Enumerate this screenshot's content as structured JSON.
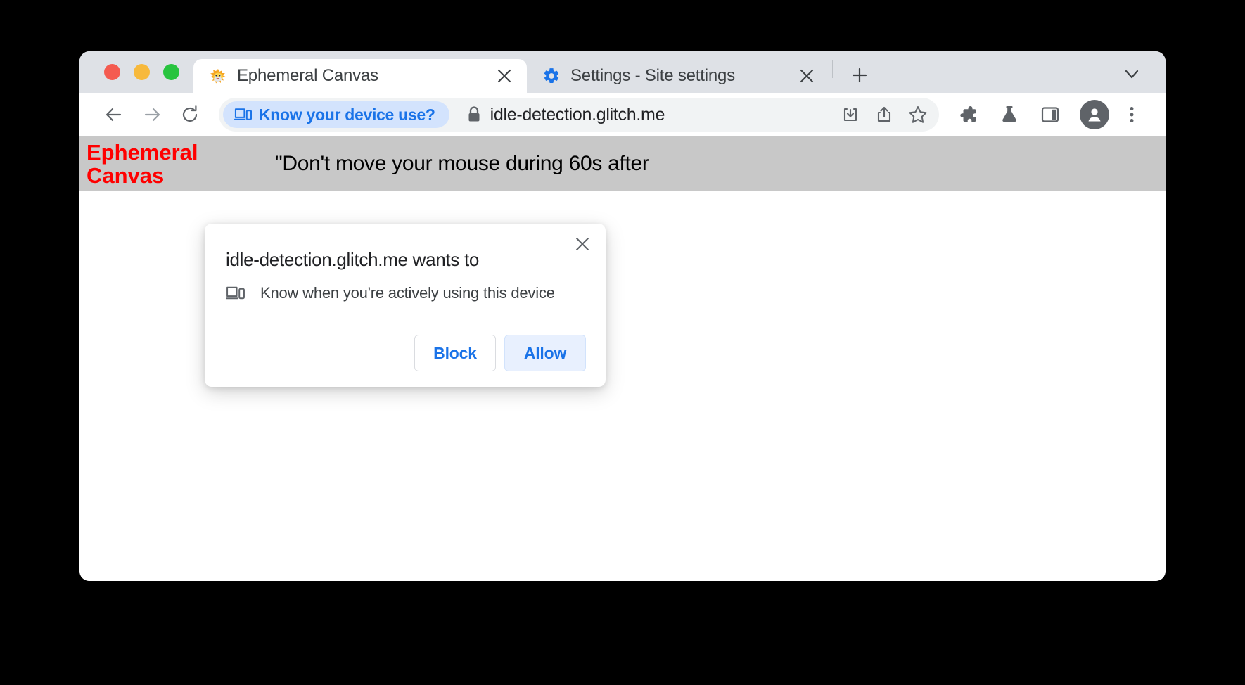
{
  "window": {
    "traffic_lights": [
      {
        "name": "close",
        "color": "#f45b50"
      },
      {
        "name": "minimize",
        "color": "#f7b93c"
      },
      {
        "name": "maximize",
        "color": "#28c43f"
      }
    ]
  },
  "tabs": [
    {
      "title": "Ephemeral Canvas",
      "favicon": "pufferfish-icon",
      "active": true,
      "close_label": "×"
    },
    {
      "title": "Settings - Site settings",
      "favicon": "gear-icon",
      "active": false,
      "close_label": "×"
    }
  ],
  "tabstrip": {
    "new_tab_label": "+",
    "tab_list_icon": "chevron-down-icon"
  },
  "toolbar": {
    "back_icon": "arrow-left-icon",
    "forward_icon": "arrow-right-icon",
    "reload_icon": "reload-icon",
    "device_chip_label": "Know your device use?",
    "device_chip_icon": "device-use-icon",
    "device_chip_bg": "#d3e3fd",
    "device_chip_fg": "#1a73e8",
    "lock_icon": "lock-icon",
    "url": "idle-detection.glitch.me",
    "download_icon": "download-icon",
    "share_icon": "share-icon",
    "bookmark_icon": "star-icon",
    "extensions_icon": "puzzle-icon",
    "labs_icon": "beaker-icon",
    "side_panel_icon": "side-panel-icon",
    "profile_icon": "avatar-person-icon",
    "menu_icon": "three-dot-menu-icon"
  },
  "page": {
    "heading": "Ephemeral Canvas",
    "heading_color": "#ff0000",
    "banner_bg": "#c8c8c8",
    "note": "\"Don't move your mouse during 60s after"
  },
  "dialog": {
    "title": "idle-detection.glitch.me wants to",
    "permission_icon": "device-use-icon",
    "permission_text": "Know when you're actively using this device",
    "close_icon": "close-icon",
    "block_label": "Block",
    "allow_label": "Allow",
    "allow_bg": "#e8f0fe",
    "accent": "#1a73e8"
  }
}
